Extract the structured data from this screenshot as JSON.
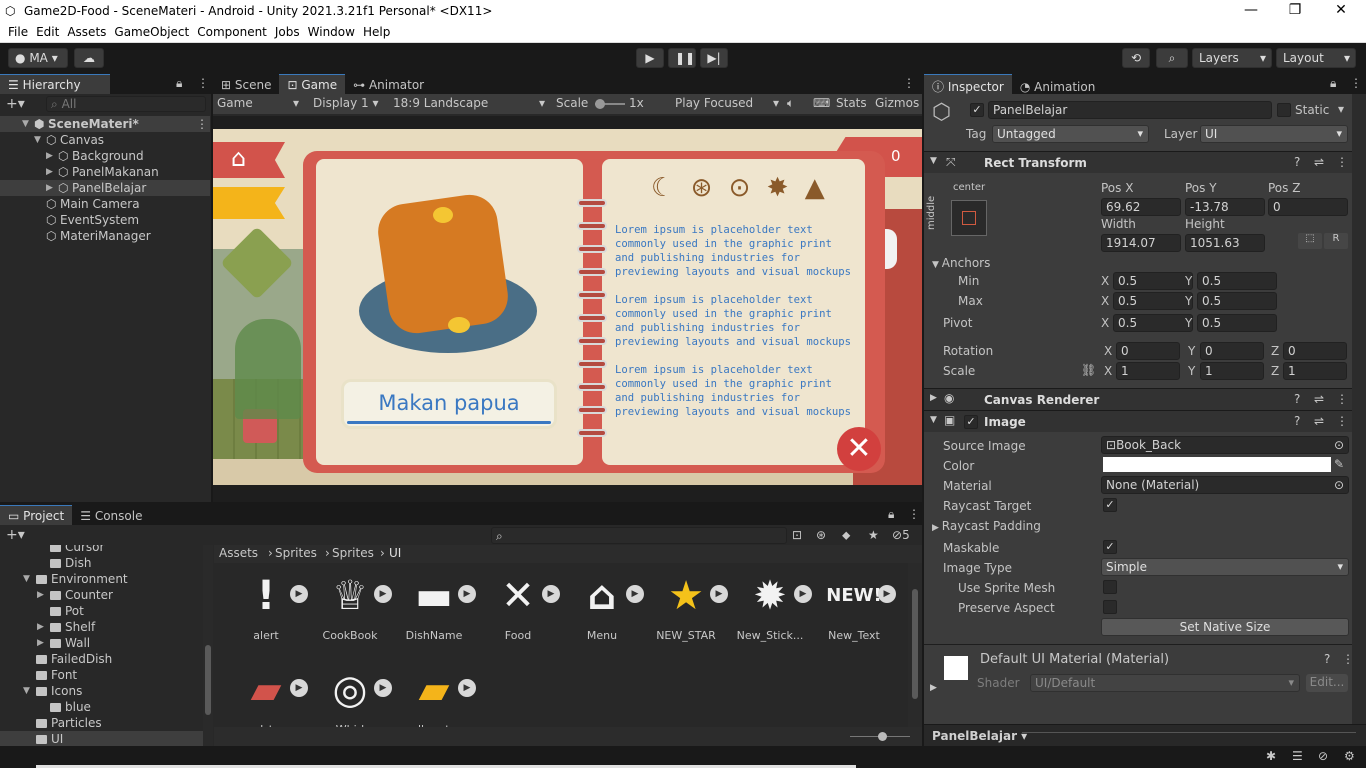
{
  "window": {
    "title": "Game2D-Food - SceneMateri - Android - Unity 2021.3.21f1 Personal* <DX11>",
    "min": "—",
    "max": "❐",
    "close": "✕"
  },
  "menu": [
    "File",
    "Edit",
    "Assets",
    "GameObject",
    "Component",
    "Jobs",
    "Window",
    "Help"
  ],
  "toolbar": {
    "account": "MA",
    "layers": "Layers",
    "layout": "Layout"
  },
  "hierarchy": {
    "tab": "Hierarchy",
    "search": "All",
    "rows": [
      {
        "label": "SceneMateri*",
        "indent": 0,
        "bold": true
      },
      {
        "label": "Canvas",
        "indent": 1
      },
      {
        "label": "Background",
        "indent": 2
      },
      {
        "label": "PanelMakanan",
        "indent": 2
      },
      {
        "label": "PanelBelajar",
        "indent": 2,
        "selected": true
      },
      {
        "label": "Main Camera",
        "indent": 1
      },
      {
        "label": "EventSystem",
        "indent": 1
      },
      {
        "label": "MateriManager",
        "indent": 1
      }
    ]
  },
  "sceneTabs": [
    "Scene",
    "Game",
    "Animator"
  ],
  "gameBar": {
    "mode": "Game",
    "display": "Display 1",
    "aspect": "18:9 Landscape",
    "scale_label": "Scale",
    "scale_value": "1x",
    "play": "Play Focused",
    "stats": "Stats",
    "gizmos": "Gizmos"
  },
  "game": {
    "food_title": "Makan papua",
    "score": "0",
    "paragraphs": [
      "Lorem ipsum is placeholder text commonly used in the graphic print and publishing industries for previewing layouts and visual mockups",
      "Lorem ipsum is placeholder text commonly used in the graphic print and publishing industries for previewing layouts and visual mockups",
      "Lorem ipsum is placeholder text commonly used in the graphic print and publishing industries for previewing layouts and visual mockups"
    ]
  },
  "inspector": {
    "tabs": [
      "Inspector",
      "Animation"
    ],
    "name": "PanelBelajar",
    "static": "Static",
    "tag_label": "Tag",
    "tag": "Untagged",
    "layer_label": "Layer",
    "layer": "UI",
    "rect": {
      "title": "Rect Transform",
      "anchor_h": "center",
      "anchor_v": "middle",
      "posx_l": "Pos X",
      "posy_l": "Pos Y",
      "posz_l": "Pos Z",
      "posx": "69.62",
      "posy": "-13.78",
      "posz": "0",
      "w_l": "Width",
      "h_l": "Height",
      "w": "1914.07",
      "h": "1051.63",
      "r": "R",
      "anchors": "Anchors",
      "min": "Min",
      "max": "Max",
      "pivot": "Pivot",
      "rotation": "Rotation",
      "scale": "Scale",
      "min_x": "0.5",
      "min_y": "0.5",
      "max_x": "0.5",
      "max_y": "0.5",
      "piv_x": "0.5",
      "piv_y": "0.5",
      "rot_x": "0",
      "rot_y": "0",
      "rot_z": "0",
      "sc_x": "1",
      "sc_y": "1",
      "sc_z": "1",
      "X": "X",
      "Y": "Y",
      "Z": "Z"
    },
    "canvasRenderer": "Canvas Renderer",
    "image": {
      "title": "Image",
      "source_l": "Source Image",
      "source": "Book_Back",
      "color_l": "Color",
      "material_l": "Material",
      "material": "None (Material)",
      "raycast_l": "Raycast Target",
      "raycast_pad": "Raycast Padding",
      "maskable_l": "Maskable",
      "type_l": "Image Type",
      "type": "Simple",
      "spritemesh": "Use Sprite Mesh",
      "aspect": "Preserve Aspect",
      "native": "Set Native Size"
    },
    "material": {
      "title": "Default UI Material (Material)",
      "shader_l": "Shader",
      "shader": "UI/Default",
      "edit": "Edit..."
    },
    "footer": "PanelBelajar"
  },
  "project": {
    "tabs": [
      "Project",
      "Console"
    ],
    "hidden_count": "5",
    "breadcrumb": [
      "Assets",
      "Sprites",
      "Sprites",
      "UI"
    ],
    "tree": [
      {
        "label": "Cursor",
        "indent": 3
      },
      {
        "label": "Dish",
        "indent": 3
      },
      {
        "label": "Environment",
        "indent": 2,
        "open": true
      },
      {
        "label": "Counter",
        "indent": 3,
        "arrow": true
      },
      {
        "label": "Pot",
        "indent": 3
      },
      {
        "label": "Shelf",
        "indent": 3,
        "arrow": true
      },
      {
        "label": "Wall",
        "indent": 3,
        "arrow": true
      },
      {
        "label": "FailedDish",
        "indent": 2
      },
      {
        "label": "Font",
        "indent": 2
      },
      {
        "label": "Icons",
        "indent": 2,
        "open": true
      },
      {
        "label": "blue",
        "indent": 3
      },
      {
        "label": "Particles",
        "indent": 2
      },
      {
        "label": "UI",
        "indent": 2,
        "selected": true
      }
    ],
    "assets": [
      "alert",
      "CookBook",
      "DishName",
      "Food",
      "Menu",
      "NEW_STAR",
      "New_Stick...",
      "New_Text",
      "red_tag",
      "Whirl",
      "yellow_tag"
    ]
  }
}
